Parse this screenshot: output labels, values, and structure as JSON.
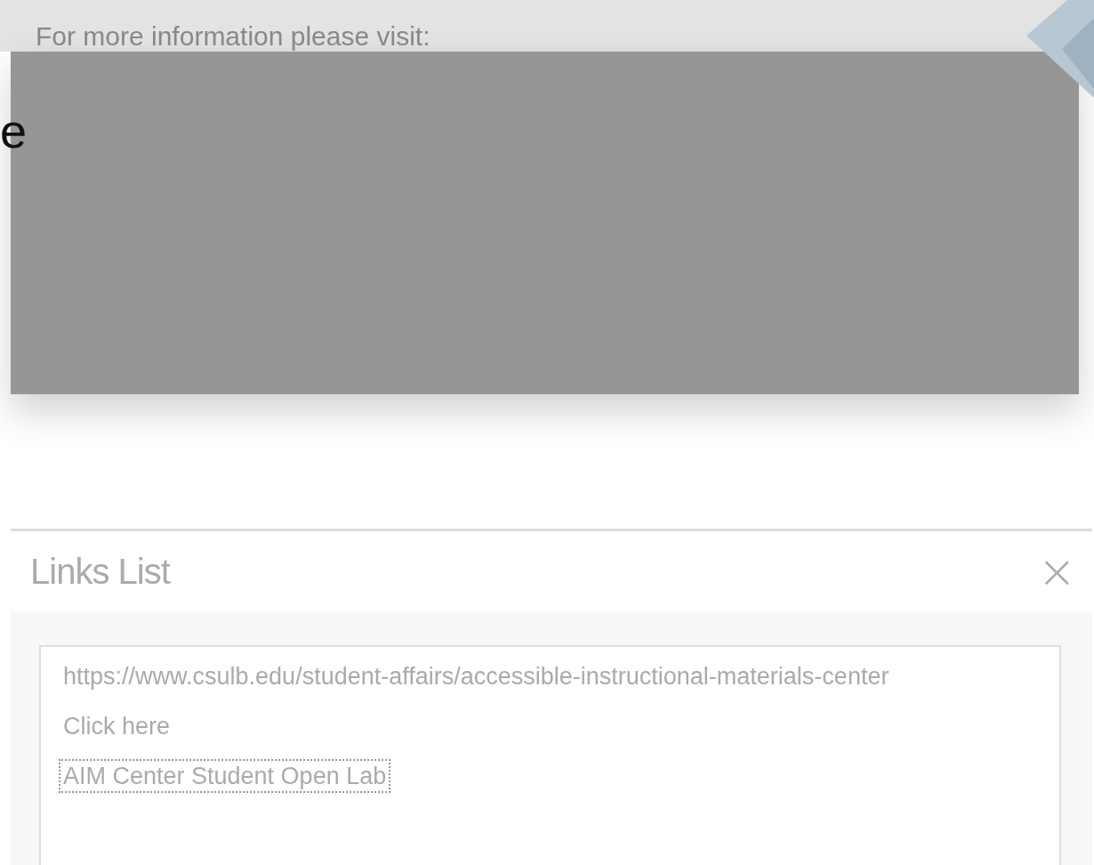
{
  "page": {
    "info_text": "For more information please visit:",
    "cut_letter": "e"
  },
  "dialog": {
    "title": "Links List",
    "close": "×",
    "links": [
      {
        "label": "https://www.csulb.edu/student-affairs/accessible-instructional-materials-center",
        "selected": false
      },
      {
        "label": "Click here",
        "selected": false
      },
      {
        "label": "AIM Center Student Open Lab",
        "selected": true
      }
    ]
  }
}
